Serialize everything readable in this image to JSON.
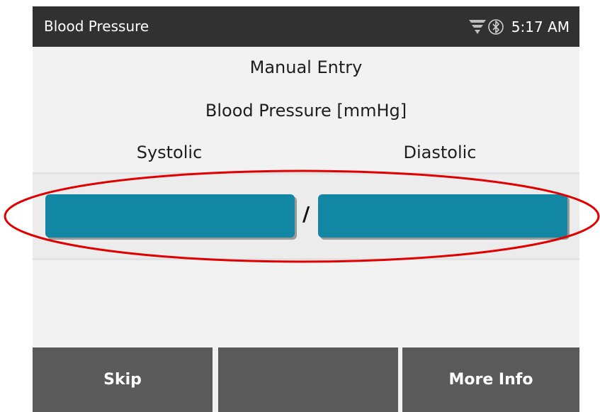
{
  "status_bar": {
    "title": "Blood Pressure",
    "time": "5:17 AM",
    "icons": [
      "signal-funnel-icon",
      "bluetooth-icon"
    ]
  },
  "header": {
    "subtitle": "Manual Entry",
    "measurement_label": "Blood Pressure [mmHg]"
  },
  "fields": {
    "systolic_label": "Systolic",
    "diastolic_label": "Diastolic",
    "separator": "/",
    "systolic_value": "",
    "diastolic_value": ""
  },
  "footer": {
    "skip_label": "Skip",
    "middle_label": "",
    "more_info_label": "More Info"
  },
  "colors": {
    "status_bar_bg": "#313131",
    "screen_bg": "#f2f2f2",
    "field_fill": "#1287a3",
    "footer_button_bg": "#5a5a5a",
    "annotation_ellipse": "#e00000"
  }
}
